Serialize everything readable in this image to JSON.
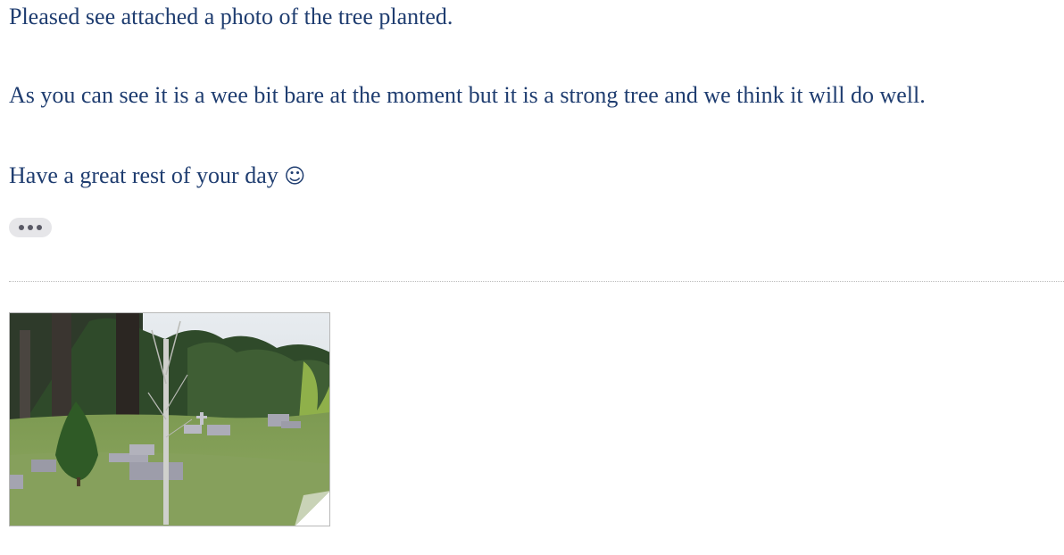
{
  "message": {
    "paragraph_1": "Pleased see attached a photo of the tree planted.",
    "paragraph_2": "As you can see it is a wee bit bare at the moment but it is a strong tree and we think it will do well.",
    "paragraph_3": "Have a great rest of your day",
    "smiley": "☺"
  },
  "more_button": {
    "icon": "ellipsis-icon"
  },
  "attachment": {
    "type": "photo-thumbnail",
    "icon": "page-curl-icon"
  },
  "colors": {
    "text": "#1f3d70",
    "more_button_bg": "#e6e6e9",
    "separator": "#bdbdbd"
  }
}
